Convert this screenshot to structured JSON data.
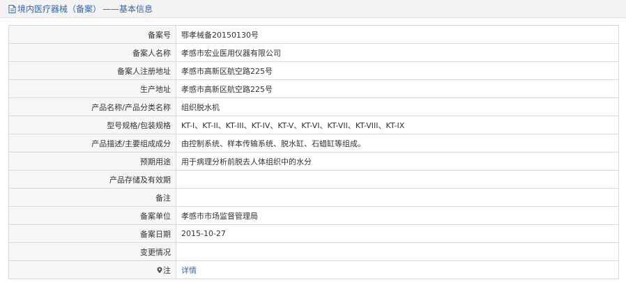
{
  "header": {
    "title": "境内医疗器械（备案）",
    "subtitle": "——基本信息",
    "title_color": "#2f66b3"
  },
  "rows": [
    {
      "label": "备案号",
      "value": "鄂孝械备20150130号"
    },
    {
      "label": "备案人名称",
      "value": "孝感市宏业医用仪器有限公司"
    },
    {
      "label": "备案人注册地址",
      "value": "孝感市高新区航空路225号"
    },
    {
      "label": "生产地址",
      "value": "孝感市高新区航空路225号"
    },
    {
      "label": "产品名称/产品分类名称",
      "value": "组织脱水机"
    },
    {
      "label": "型号规格/包装规格",
      "value": "KT-I、KT-II、KT-III、KT-IV、KT-V、KT-VI、KT-VII、KT-VIII、KT-IX"
    },
    {
      "label": "产品描述/主要组成成分",
      "value": "由控制系统、样本传输系统、脱水缸、石蜡缸等组成。"
    },
    {
      "label": "预期用途",
      "value": "用于病理分析前脱去人体组织中的水分"
    },
    {
      "label": "产品存储及有效期",
      "value": ""
    },
    {
      "label": "备注",
      "value": ""
    },
    {
      "label": "备案单位",
      "value": "孝感市市场监督管理局"
    },
    {
      "label": "备案日期",
      "value": "2015-10-27"
    },
    {
      "label": "变更情况",
      "value": ""
    }
  ],
  "note_row": {
    "label": "注",
    "link_text": "详情",
    "icon": "pin-icon"
  }
}
